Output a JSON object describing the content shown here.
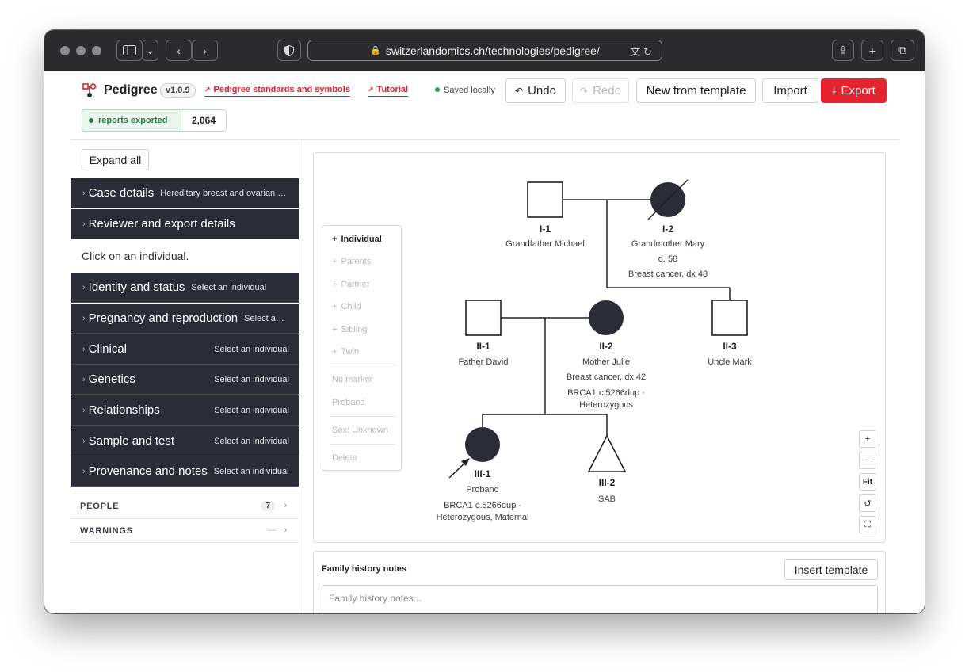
{
  "browser": {
    "url": "switzerlandomics.ch/technologies/pedigree/",
    "lock_icon": "lock-icon",
    "colors": {
      "titlebar": "#2b2b2d"
    }
  },
  "header": {
    "app_name": "Pedigree",
    "version": "v1.0.9",
    "links": [
      {
        "label": "Pedigree standards and symbols"
      },
      {
        "label": "Tutorial"
      }
    ],
    "saved_status": "Saved locally",
    "undo_label": "Undo",
    "redo_label": "Redo",
    "new_template_label": "New from template",
    "import_label": "Import",
    "export_label": "Export",
    "reports_label": "reports exported",
    "reports_count": "2,064",
    "colors": {
      "accent": "#e5242f",
      "saved_dot": "#2f9e55"
    }
  },
  "sidebar": {
    "expand_all": "Expand all",
    "hint": "Click on an individual.",
    "sections": [
      {
        "title": "Case details",
        "subtitle": "Hereditary breast and ovarian cancer"
      },
      {
        "title": "Reviewer and export details",
        "subtitle": ""
      },
      {
        "title": "Identity and status",
        "subtitle": "Select an individual"
      },
      {
        "title": "Pregnancy and reproduction",
        "subtitle": "Select an individual"
      },
      {
        "title": "Clinical",
        "subtitle": "Select an individual"
      },
      {
        "title": "Genetics",
        "subtitle": "Select an individual"
      },
      {
        "title": "Relationships",
        "subtitle": "Select an individual"
      },
      {
        "title": "Sample and test",
        "subtitle": "Select an individual"
      },
      {
        "title": "Provenance and notes",
        "subtitle": "Select an individual"
      }
    ],
    "people_label": "PEOPLE",
    "people_count": "7",
    "warnings_label": "WARNINGS",
    "warnings_value": "—",
    "colors": {
      "section_bg": "#2a2c38"
    }
  },
  "context_menu": {
    "items": [
      {
        "label": "Individual",
        "prefix": "+",
        "enabled": true
      },
      {
        "label": "Parents",
        "prefix": "+",
        "enabled": false
      },
      {
        "label": "Partner",
        "prefix": "+",
        "enabled": false
      },
      {
        "label": "Child",
        "prefix": "+",
        "enabled": false
      },
      {
        "label": "Sibling",
        "prefix": "+",
        "enabled": false
      },
      {
        "label": "Twin",
        "prefix": "+",
        "enabled": false
      },
      {
        "label": "No marker",
        "prefix": "",
        "enabled": false
      },
      {
        "label": "Proband",
        "prefix": "",
        "enabled": false
      },
      {
        "label": "Sex: Unknown",
        "prefix": "",
        "enabled": false
      },
      {
        "label": "Delete",
        "prefix": "",
        "enabled": false
      }
    ]
  },
  "pedigree": {
    "individuals": [
      {
        "id": "I-1",
        "sex": "male",
        "affected": false,
        "deceased": false,
        "proband": false,
        "lines": [
          "Grandfather Michael"
        ]
      },
      {
        "id": "I-2",
        "sex": "female",
        "affected": true,
        "deceased": true,
        "proband": false,
        "lines": [
          "Grandmother Mary",
          "d. 58",
          "Breast cancer, dx 48"
        ]
      },
      {
        "id": "II-1",
        "sex": "male",
        "affected": false,
        "deceased": false,
        "proband": false,
        "lines": [
          "Father David"
        ]
      },
      {
        "id": "II-2",
        "sex": "female",
        "affected": true,
        "deceased": false,
        "proband": false,
        "lines": [
          "Mother Julie",
          "Breast cancer, dx 42",
          "BRCA1 c.5266dup ·",
          "Heterozygous"
        ]
      },
      {
        "id": "II-3",
        "sex": "male",
        "affected": false,
        "deceased": false,
        "proband": false,
        "lines": [
          "Uncle Mark"
        ]
      },
      {
        "id": "III-1",
        "sex": "female",
        "affected": true,
        "deceased": false,
        "proband": true,
        "lines": [
          "Proband",
          "BRCA1 c.5266dup ·",
          "Heterozygous, Maternal"
        ]
      },
      {
        "id": "III-2",
        "sex": "pregnancy-loss",
        "affected": false,
        "deceased": false,
        "proband": false,
        "lines": [
          "SAB"
        ]
      }
    ],
    "zoom_controls": [
      "+",
      "−",
      "Fit",
      "↺",
      "⛶"
    ],
    "colors": {
      "affected": "#2a2c38",
      "line": "#1f2024"
    }
  },
  "notes": {
    "title": "Family history notes",
    "insert_label": "Insert template",
    "placeholder": "Family history notes..."
  }
}
